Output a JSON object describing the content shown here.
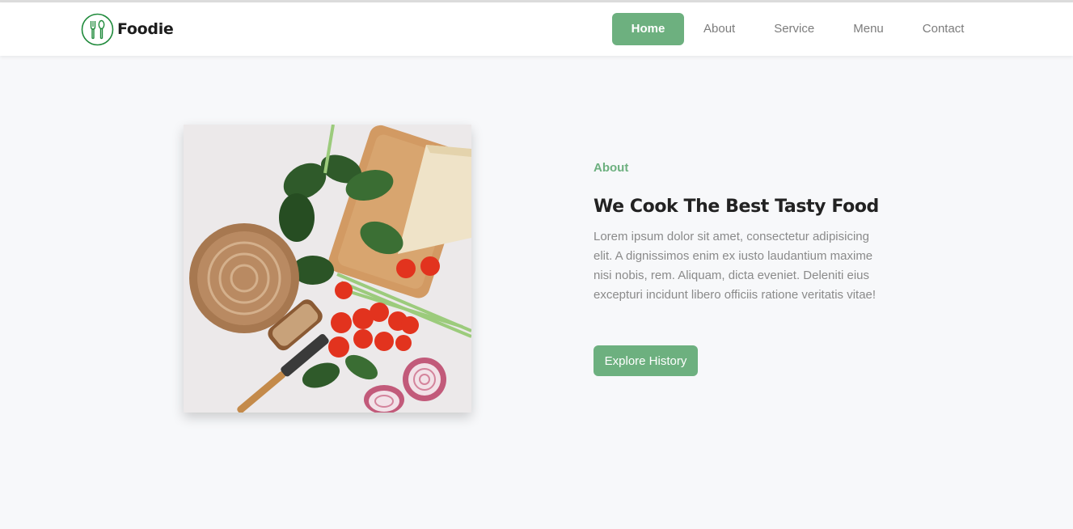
{
  "brand": {
    "name": "Foodie",
    "logo_icon": "utensils-circle-icon",
    "accent": "#6db07f",
    "logo_color": "#1f8a3b"
  },
  "nav": {
    "items": [
      {
        "label": "Home",
        "active": true
      },
      {
        "label": "About",
        "active": false
      },
      {
        "label": "Service",
        "active": false
      },
      {
        "label": "Menu",
        "active": false
      },
      {
        "label": "Contact",
        "active": false
      }
    ]
  },
  "about": {
    "label": "About",
    "title": "We Cook The Best Tasty Food",
    "description": "Lorem ipsum dolor sit amet, consectetur adipisicing elit. A dignissimos enim ex iusto laudantium maxime nisi nobis, rem. Aliquam, dicta eveniet. Deleniti eius excepturi incidunt libero officiis ratione veritatis vitae!",
    "button_label": "Explore History"
  }
}
